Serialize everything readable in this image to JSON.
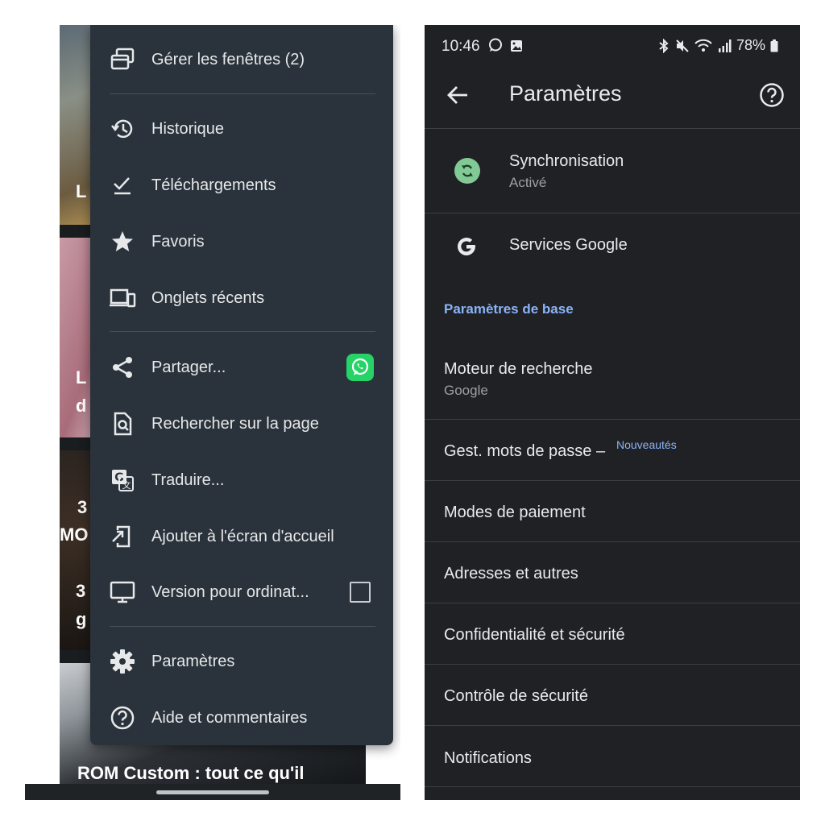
{
  "left": {
    "menu": {
      "manage_windows": "Gérer les fenêtres (2)",
      "history": "Historique",
      "downloads": "Téléchargements",
      "bookmarks": "Favoris",
      "recent_tabs": "Onglets récents",
      "share": "Partager...",
      "find_in_page": "Rechercher sur la page",
      "translate": "Traduire...",
      "add_to_home": "Ajouter à l'écran d'accueil",
      "desktop_site": "Version pour ordinat...",
      "settings": "Paramètres",
      "help": "Aide et commentaires"
    },
    "background": {
      "frag_1": "L",
      "frag_2a": "L",
      "frag_2b": "d",
      "frag_3a": "3",
      "frag_3b": "MO",
      "frag_3c": "3",
      "frag_3d": "g",
      "article_title": "ROM Custom : tout ce qu'il"
    }
  },
  "right": {
    "status": {
      "time": "10:46",
      "battery": "78%"
    },
    "title": "Paramètres",
    "sync": {
      "title": "Synchronisation",
      "subtitle": "Activé"
    },
    "google_services": "Services Google",
    "section_basic": "Paramètres de base",
    "search_engine": {
      "title": "Moteur de recherche",
      "subtitle": "Google"
    },
    "passwords": {
      "title": "Gest. mots de passe –",
      "badge": "Nouveautés"
    },
    "payments": "Modes de paiement",
    "addresses": "Adresses et autres",
    "privacy": "Confidentialité et sécurité",
    "safety_check": "Contrôle de sécurité",
    "notifications": "Notifications"
  },
  "colors": {
    "menu_bg": "#2a333b",
    "settings_bg": "#202124",
    "accent_blue": "#8ab4f8",
    "sync_green": "#81c995",
    "whatsapp_green": "#25d366"
  }
}
